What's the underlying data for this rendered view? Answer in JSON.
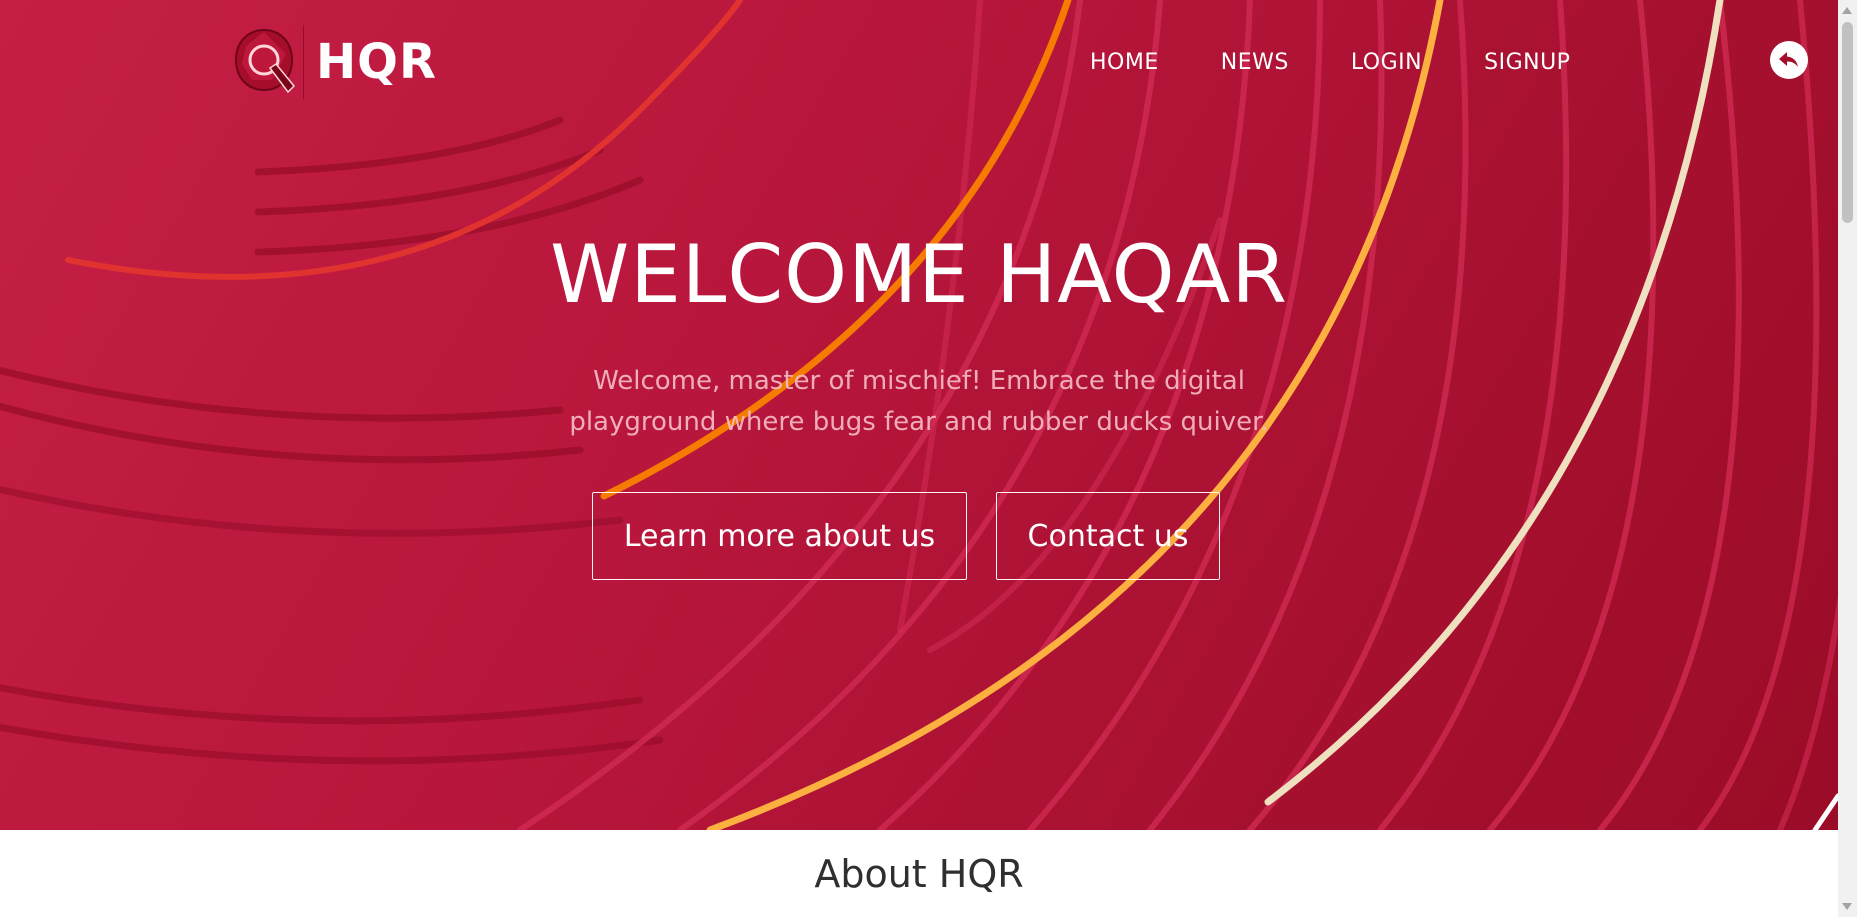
{
  "header": {
    "logo_text": "HQR",
    "logo_letter": "Q",
    "nav": [
      {
        "label": "HOME"
      },
      {
        "label": "NEWS"
      },
      {
        "label": "LOGIN"
      },
      {
        "label": "SIGNUP"
      }
    ],
    "back_icon": "reply-arrow-icon"
  },
  "hero": {
    "title": "WELCOME HAQAR",
    "subtitle_line1": "Welcome, master of mischief! Embrace the digital",
    "subtitle_line2": "playground where bugs fear and rubber ducks quiver.",
    "learn_button": "Learn more about us",
    "contact_button": "Contact us"
  },
  "about": {
    "title": "About HQR"
  },
  "colors": {
    "hero_start": "#c51f45",
    "hero_end": "#9a0c27",
    "orange_line": "#f57c00",
    "yellow_line": "#fbb040",
    "cream_line": "#efe0c0"
  }
}
